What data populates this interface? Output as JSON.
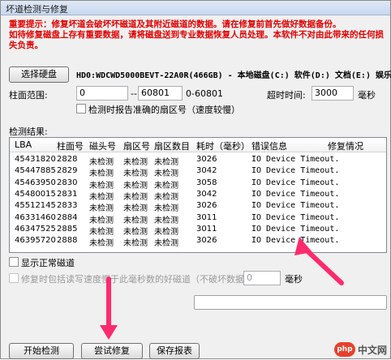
{
  "window": {
    "title": "坏道检测与修复"
  },
  "warning": {
    "line1": "重要提示：修复坏道会破坏坏磁道及其附近磁道的数据。请在修复前首先做好数据备份。",
    "line2": "如待修复磁盘上存有重要数据，请将磁盘送到专业数据恢复人员处理。本软件不对由此带来的任何损失负责。"
  },
  "disk": {
    "select_label": "选择硬盘",
    "info": "HD0:WDCWD5000BEVT-22A0R(466GB) - 本地磁盘(C:) 软件(D:) 文档(E:) 娱乐"
  },
  "range": {
    "label": "柱面范围:",
    "start": "0",
    "arrow": "-->",
    "end": "60801",
    "max": "0-60801",
    "timeout_label": "超时时间:",
    "timeout_value": "3000",
    "timeout_unit": "毫秒"
  },
  "report_sector": {
    "label": "检测时报告准确的扇区号（速度较慢）"
  },
  "results": {
    "label": "检测结果:",
    "columns": [
      "LBA",
      "柱面号",
      "磁头号",
      "扇区号",
      "扇区数目",
      "耗时（毫秒）",
      "错误信息",
      "修复情况"
    ],
    "rows": [
      [
        "45431820",
        "2828",
        "未检测",
        "未检测",
        "未检测",
        "3026",
        "IO Device Timeout.",
        ""
      ],
      [
        "45447885",
        "2829",
        "未检测",
        "未检测",
        "未检测",
        "3042",
        "IO Device Timeout.",
        ""
      ],
      [
        "45463950",
        "2830",
        "未检测",
        "未检测",
        "未检测",
        "3058",
        "IO Device Timeout.",
        ""
      ],
      [
        "45480015",
        "2831",
        "未检测",
        "未检测",
        "未检测",
        "3042",
        "IO Device Timeout.",
        ""
      ],
      [
        "45512145",
        "2833",
        "未检测",
        "未检测",
        "未检测",
        "3026",
        "IO Device Timeout.",
        ""
      ],
      [
        "46331460",
        "2884",
        "未检测",
        "未检测",
        "未检测",
        "3011",
        "IO Device Timeout.",
        ""
      ],
      [
        "46347525",
        "2885",
        "未检测",
        "未检测",
        "未检测",
        "3011",
        "IO Device Timeout.",
        ""
      ],
      [
        "46395720",
        "2888",
        "未检测",
        "未检测",
        "未检测",
        "3026",
        "IO Device Timeout.",
        ""
      ]
    ]
  },
  "show_normal": {
    "label": "显示正常磁道"
  },
  "repair_option": {
    "label": "修复时包括读写速度慢于此毫秒数的好磁道（不破坏数据）",
    "value": "0",
    "unit": "毫秒"
  },
  "buttons": {
    "start": "开始检测",
    "repair": "尝试修复",
    "save": "保存报表"
  },
  "watermark": {
    "logo": "php",
    "text": "中文网"
  },
  "colors": {
    "warning": "#e00000",
    "arrow": "#ff2a6d"
  }
}
